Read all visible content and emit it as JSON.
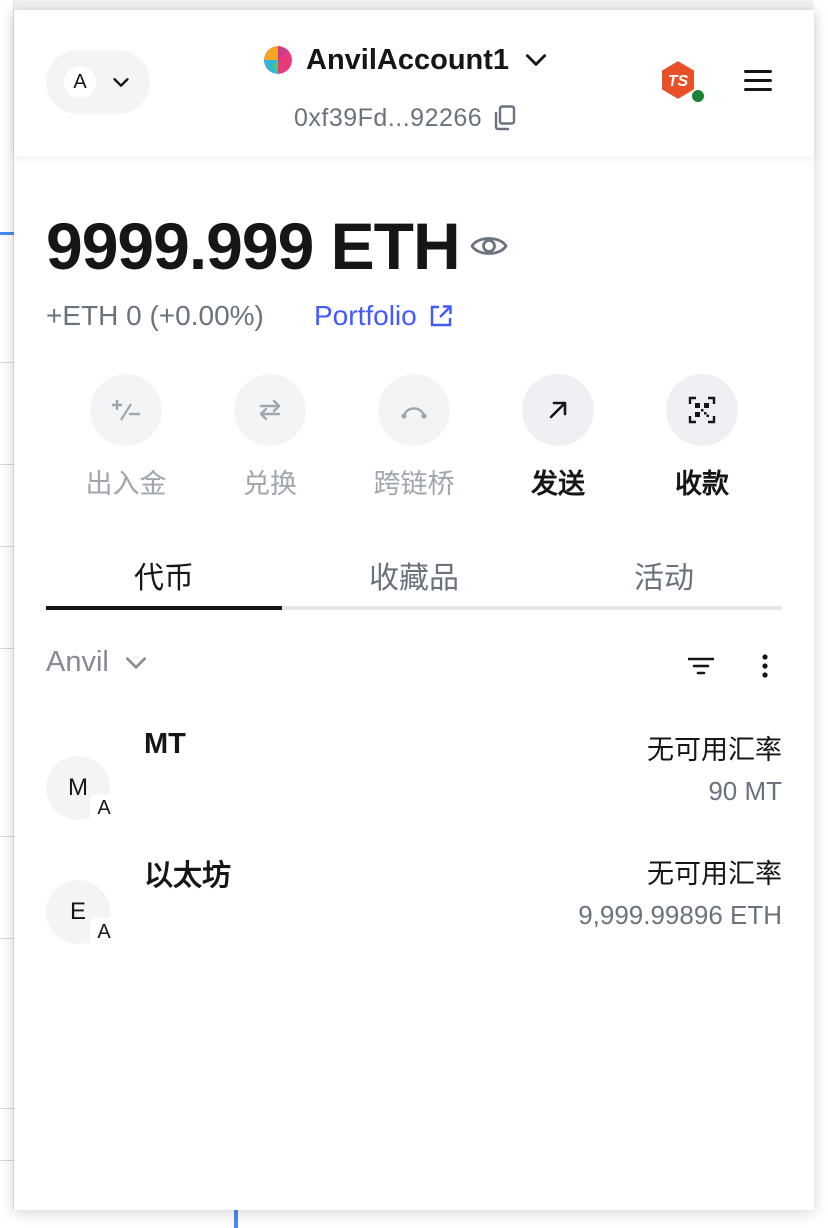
{
  "header": {
    "network_avatar": "A",
    "account_name": "AnvilAccount1",
    "address": "0xf39Fd...92266",
    "badge_text": "TS"
  },
  "balance": {
    "amount": "9999.999 ETH",
    "change": "+ETH 0 (+0.00%)",
    "portfolio_label": "Portfolio"
  },
  "actions": [
    {
      "label": "出入金",
      "icon": "buy-sell-icon",
      "enabled": false
    },
    {
      "label": "兑换",
      "icon": "swap-icon",
      "enabled": false
    },
    {
      "label": "跨链桥",
      "icon": "bridge-icon",
      "enabled": false
    },
    {
      "label": "发送",
      "icon": "send-arrow-icon",
      "enabled": true
    },
    {
      "label": "收款",
      "icon": "qr-code-icon",
      "enabled": true
    }
  ],
  "tabs": [
    {
      "label": "代币",
      "active": true
    },
    {
      "label": "收藏品",
      "active": false
    },
    {
      "label": "活动",
      "active": false
    }
  ],
  "filter": {
    "network_label": "Anvil"
  },
  "tokens": [
    {
      "avatar": "M",
      "badge": "A",
      "name": "MT",
      "rate": "无可用汇率",
      "amount": "90 MT"
    },
    {
      "avatar": "E",
      "badge": "A",
      "name": "以太坊",
      "rate": "无可用汇率",
      "amount": "9,999.99896 ETH"
    }
  ],
  "colors": {
    "accent": "#4459ff",
    "text_primary": "#141618",
    "text_muted": "#6a737d",
    "status_green": "#1c8234"
  }
}
